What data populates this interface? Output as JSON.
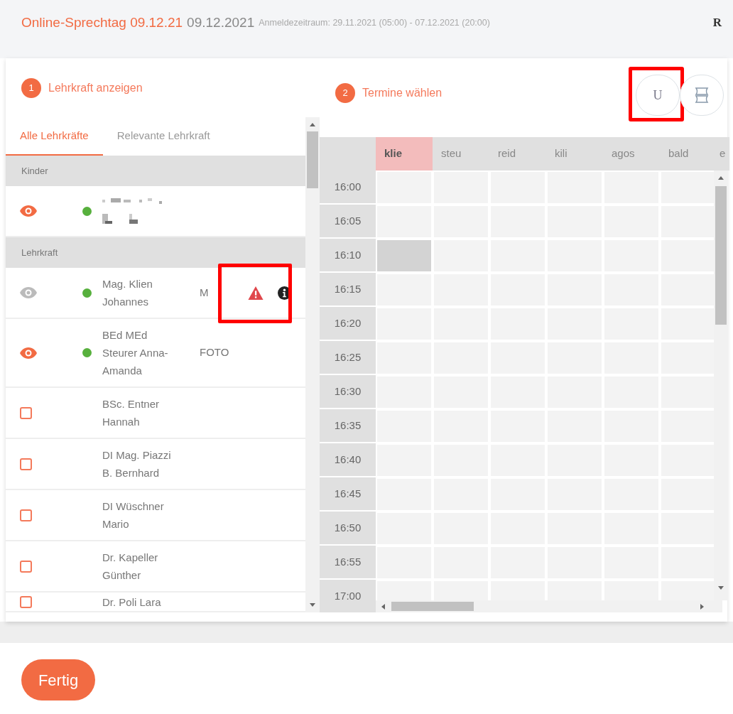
{
  "header": {
    "title": "Online-Sprechtag 09.12.21",
    "date": "09.12.2021",
    "period": "Anmeldezeitraum: 29.11.2021 (05:00) - 07.12.2021 (20:00)",
    "user_initial": "R"
  },
  "steps": [
    {
      "number": "1",
      "label": "Lehrkraft anzeigen"
    },
    {
      "number": "2",
      "label": "Termine wählen"
    }
  ],
  "tabs": [
    {
      "label": "Alle Lehrkräfte",
      "selected": true
    },
    {
      "label": "Relevante Lehrkraft",
      "selected": false
    }
  ],
  "sections": [
    {
      "heading": "Kinder",
      "rows": [
        {
          "kind": "redacted",
          "shown": true,
          "online": true
        }
      ]
    },
    {
      "heading": "Lehrkraft",
      "rows": [
        {
          "kind": "eye",
          "shown": false,
          "online": true,
          "name": [
            "Mag. Klien",
            "Johannes"
          ],
          "tag": "M",
          "warning": true,
          "info": true,
          "annotated": true
        },
        {
          "kind": "eye",
          "shown": true,
          "online": true,
          "name": [
            "BEd MEd",
            "Steurer Anna-",
            "Amanda"
          ],
          "tag": "FOTO",
          "warning": false,
          "info": false,
          "annotated": false
        },
        {
          "kind": "checkbox",
          "checked": false,
          "name": [
            "BSc. Entner",
            "Hannah"
          ]
        },
        {
          "kind": "checkbox",
          "checked": false,
          "name": [
            "DI Mag. Piazzi",
            "B. Bernhard"
          ]
        },
        {
          "kind": "checkbox",
          "checked": false,
          "name": [
            "DI Wüschner",
            "Mario"
          ]
        },
        {
          "kind": "checkbox",
          "checked": false,
          "name": [
            "Dr. Kapeller",
            "Günther"
          ]
        },
        {
          "kind": "checkbox",
          "checked": false,
          "name": [
            "Dr. Poli Lara"
          ]
        }
      ]
    }
  ],
  "view_buttons": [
    {
      "kind": "letter",
      "label": "U",
      "annotated": true
    },
    {
      "kind": "scroll",
      "annotated": false
    }
  ],
  "grid": {
    "columns": [
      {
        "label": "klie",
        "selected": true
      },
      {
        "label": "steu",
        "selected": false
      },
      {
        "label": "reid",
        "selected": false
      },
      {
        "label": "kili",
        "selected": false
      },
      {
        "label": "agos",
        "selected": false
      },
      {
        "label": "bald",
        "selected": false
      },
      {
        "label": "e",
        "selected": false
      }
    ],
    "slots": [
      {
        "time": "16:00",
        "blocked": [
          false,
          false,
          false,
          false,
          false,
          false
        ]
      },
      {
        "time": "16:05",
        "blocked": [
          false,
          false,
          false,
          false,
          false,
          false
        ]
      },
      {
        "time": "16:10",
        "blocked": [
          true,
          false,
          false,
          false,
          false,
          false
        ]
      },
      {
        "time": "16:15",
        "blocked": [
          false,
          false,
          false,
          false,
          false,
          false
        ]
      },
      {
        "time": "16:20",
        "blocked": [
          false,
          false,
          false,
          false,
          false,
          false
        ]
      },
      {
        "time": "16:25",
        "blocked": [
          false,
          false,
          false,
          false,
          false,
          false
        ]
      },
      {
        "time": "16:30",
        "blocked": [
          false,
          false,
          false,
          false,
          false,
          false
        ]
      },
      {
        "time": "16:35",
        "blocked": [
          false,
          false,
          false,
          false,
          false,
          false
        ]
      },
      {
        "time": "16:40",
        "blocked": [
          false,
          false,
          false,
          false,
          false,
          false
        ]
      },
      {
        "time": "16:45",
        "blocked": [
          false,
          false,
          false,
          false,
          false,
          false
        ]
      },
      {
        "time": "16:50",
        "blocked": [
          false,
          false,
          false,
          false,
          false,
          false
        ]
      },
      {
        "time": "16:55",
        "blocked": [
          false,
          false,
          false,
          false,
          false,
          false
        ]
      },
      {
        "time": "17:00",
        "blocked": [
          false,
          false,
          false,
          false,
          false,
          false
        ]
      }
    ]
  },
  "footer": {
    "button": "Fertig"
  }
}
